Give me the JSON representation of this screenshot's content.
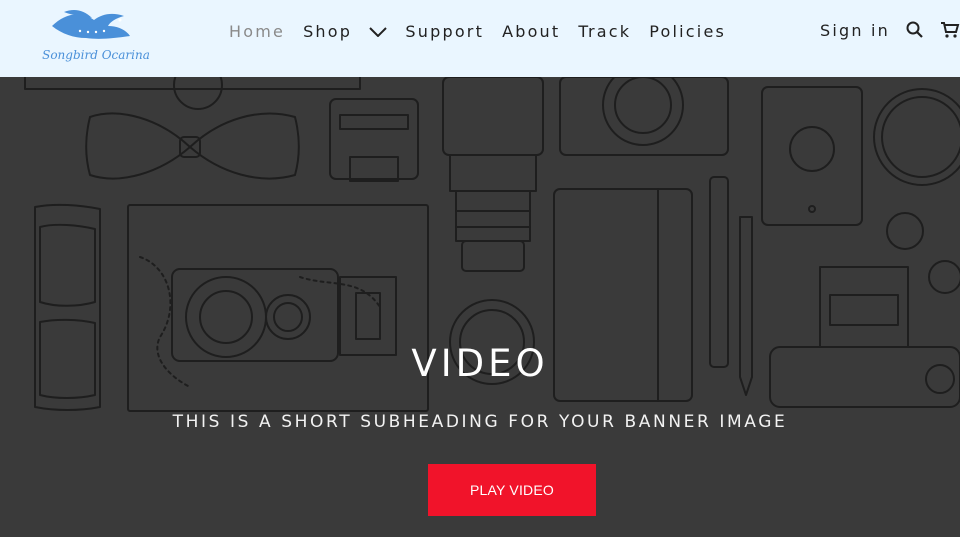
{
  "brand": {
    "name": "Songbird Ocarina",
    "logo_color": "#4a90d9"
  },
  "nav": {
    "items": [
      {
        "label": "Home",
        "active": true
      },
      {
        "label": "Shop",
        "has_dropdown": true
      },
      {
        "label": "Support"
      },
      {
        "label": "About"
      },
      {
        "label": "Track"
      },
      {
        "label": "Policies"
      }
    ]
  },
  "header_right": {
    "signin_label": "Sign in",
    "icons": [
      "search-icon",
      "cart-icon"
    ]
  },
  "hero": {
    "title": "VIDEO",
    "subheading": "THIS IS A SHORT SUBHEADING FOR YOUR BANNER IMAGE",
    "button_label": "PLAY VIDEO",
    "button_color": "#f1132a",
    "background_color": "#3a3a3a"
  }
}
